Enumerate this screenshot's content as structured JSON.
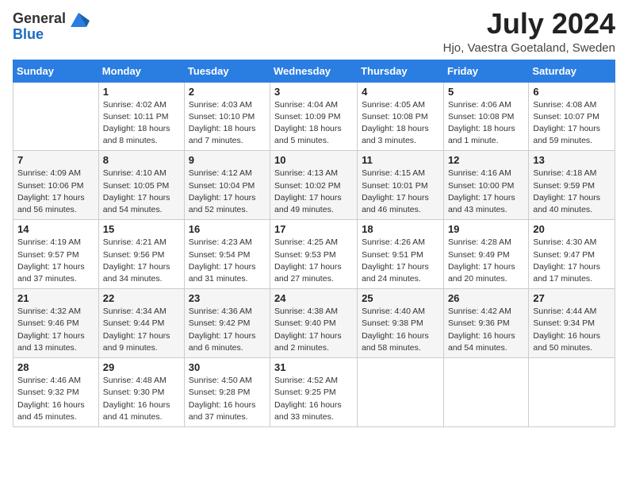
{
  "header": {
    "logo_general": "General",
    "logo_blue": "Blue",
    "month_title": "July 2024",
    "location": "Hjo, Vaestra Goetaland, Sweden"
  },
  "days_of_week": [
    "Sunday",
    "Monday",
    "Tuesday",
    "Wednesday",
    "Thursday",
    "Friday",
    "Saturday"
  ],
  "weeks": [
    [
      {
        "day": "",
        "info": ""
      },
      {
        "day": "1",
        "info": "Sunrise: 4:02 AM\nSunset: 10:11 PM\nDaylight: 18 hours\nand 8 minutes."
      },
      {
        "day": "2",
        "info": "Sunrise: 4:03 AM\nSunset: 10:10 PM\nDaylight: 18 hours\nand 7 minutes."
      },
      {
        "day": "3",
        "info": "Sunrise: 4:04 AM\nSunset: 10:09 PM\nDaylight: 18 hours\nand 5 minutes."
      },
      {
        "day": "4",
        "info": "Sunrise: 4:05 AM\nSunset: 10:08 PM\nDaylight: 18 hours\nand 3 minutes."
      },
      {
        "day": "5",
        "info": "Sunrise: 4:06 AM\nSunset: 10:08 PM\nDaylight: 18 hours\nand 1 minute."
      },
      {
        "day": "6",
        "info": "Sunrise: 4:08 AM\nSunset: 10:07 PM\nDaylight: 17 hours\nand 59 minutes."
      }
    ],
    [
      {
        "day": "7",
        "info": "Sunrise: 4:09 AM\nSunset: 10:06 PM\nDaylight: 17 hours\nand 56 minutes."
      },
      {
        "day": "8",
        "info": "Sunrise: 4:10 AM\nSunset: 10:05 PM\nDaylight: 17 hours\nand 54 minutes."
      },
      {
        "day": "9",
        "info": "Sunrise: 4:12 AM\nSunset: 10:04 PM\nDaylight: 17 hours\nand 52 minutes."
      },
      {
        "day": "10",
        "info": "Sunrise: 4:13 AM\nSunset: 10:02 PM\nDaylight: 17 hours\nand 49 minutes."
      },
      {
        "day": "11",
        "info": "Sunrise: 4:15 AM\nSunset: 10:01 PM\nDaylight: 17 hours\nand 46 minutes."
      },
      {
        "day": "12",
        "info": "Sunrise: 4:16 AM\nSunset: 10:00 PM\nDaylight: 17 hours\nand 43 minutes."
      },
      {
        "day": "13",
        "info": "Sunrise: 4:18 AM\nSunset: 9:59 PM\nDaylight: 17 hours\nand 40 minutes."
      }
    ],
    [
      {
        "day": "14",
        "info": "Sunrise: 4:19 AM\nSunset: 9:57 PM\nDaylight: 17 hours\nand 37 minutes."
      },
      {
        "day": "15",
        "info": "Sunrise: 4:21 AM\nSunset: 9:56 PM\nDaylight: 17 hours\nand 34 minutes."
      },
      {
        "day": "16",
        "info": "Sunrise: 4:23 AM\nSunset: 9:54 PM\nDaylight: 17 hours\nand 31 minutes."
      },
      {
        "day": "17",
        "info": "Sunrise: 4:25 AM\nSunset: 9:53 PM\nDaylight: 17 hours\nand 27 minutes."
      },
      {
        "day": "18",
        "info": "Sunrise: 4:26 AM\nSunset: 9:51 PM\nDaylight: 17 hours\nand 24 minutes."
      },
      {
        "day": "19",
        "info": "Sunrise: 4:28 AM\nSunset: 9:49 PM\nDaylight: 17 hours\nand 20 minutes."
      },
      {
        "day": "20",
        "info": "Sunrise: 4:30 AM\nSunset: 9:47 PM\nDaylight: 17 hours\nand 17 minutes."
      }
    ],
    [
      {
        "day": "21",
        "info": "Sunrise: 4:32 AM\nSunset: 9:46 PM\nDaylight: 17 hours\nand 13 minutes."
      },
      {
        "day": "22",
        "info": "Sunrise: 4:34 AM\nSunset: 9:44 PM\nDaylight: 17 hours\nand 9 minutes."
      },
      {
        "day": "23",
        "info": "Sunrise: 4:36 AM\nSunset: 9:42 PM\nDaylight: 17 hours\nand 6 minutes."
      },
      {
        "day": "24",
        "info": "Sunrise: 4:38 AM\nSunset: 9:40 PM\nDaylight: 17 hours\nand 2 minutes."
      },
      {
        "day": "25",
        "info": "Sunrise: 4:40 AM\nSunset: 9:38 PM\nDaylight: 16 hours\nand 58 minutes."
      },
      {
        "day": "26",
        "info": "Sunrise: 4:42 AM\nSunset: 9:36 PM\nDaylight: 16 hours\nand 54 minutes."
      },
      {
        "day": "27",
        "info": "Sunrise: 4:44 AM\nSunset: 9:34 PM\nDaylight: 16 hours\nand 50 minutes."
      }
    ],
    [
      {
        "day": "28",
        "info": "Sunrise: 4:46 AM\nSunset: 9:32 PM\nDaylight: 16 hours\nand 45 minutes."
      },
      {
        "day": "29",
        "info": "Sunrise: 4:48 AM\nSunset: 9:30 PM\nDaylight: 16 hours\nand 41 minutes."
      },
      {
        "day": "30",
        "info": "Sunrise: 4:50 AM\nSunset: 9:28 PM\nDaylight: 16 hours\nand 37 minutes."
      },
      {
        "day": "31",
        "info": "Sunrise: 4:52 AM\nSunset: 9:25 PM\nDaylight: 16 hours\nand 33 minutes."
      },
      {
        "day": "",
        "info": ""
      },
      {
        "day": "",
        "info": ""
      },
      {
        "day": "",
        "info": ""
      }
    ]
  ]
}
